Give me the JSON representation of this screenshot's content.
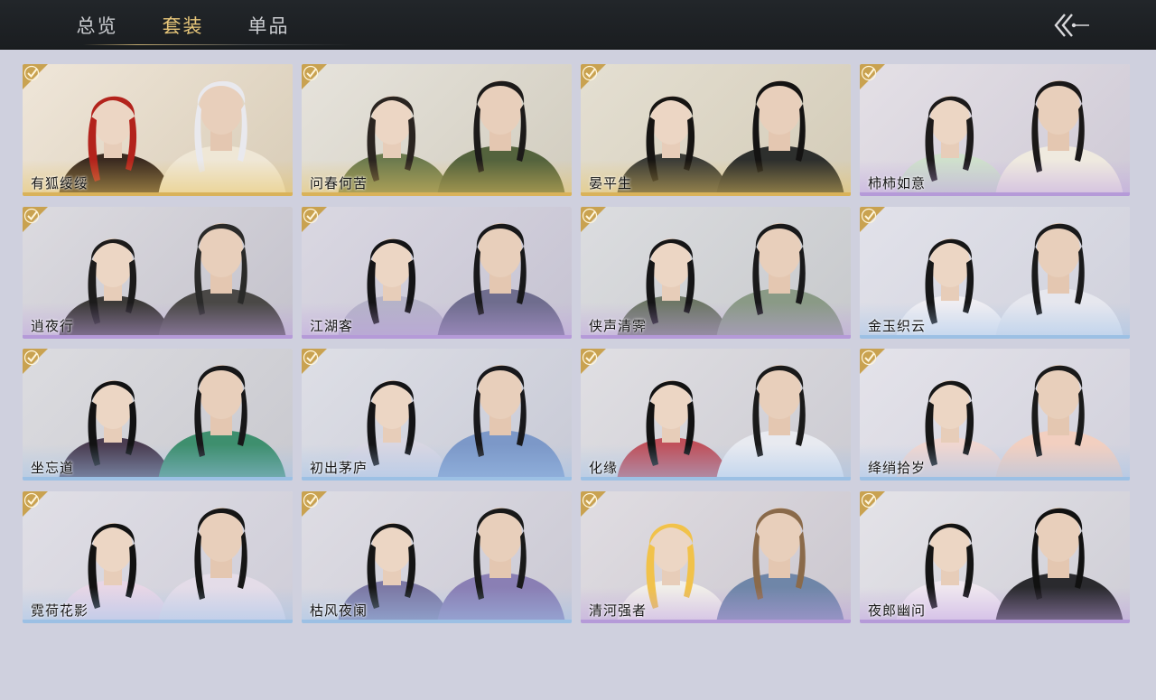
{
  "tabs": [
    {
      "label": "总览",
      "active": false
    },
    {
      "label": "套装",
      "active": true
    },
    {
      "label": "单品",
      "active": false
    }
  ],
  "back_icon": "double-chevron-back-icon",
  "check_icon": "check-corner-icon",
  "accent": "#e8c77a",
  "outfits": [
    {
      "name": "有狐绥绥",
      "owned": true,
      "tone": "gold",
      "bg": [
        "#efe6d9",
        "#d9cdb8"
      ],
      "hair": [
        "#b3231c",
        "#e9e9ee"
      ],
      "cloth": [
        "#3a2a20",
        "#efe7d6"
      ]
    },
    {
      "name": "问春何苦",
      "owned": true,
      "tone": "gold",
      "bg": [
        "#e6e3dc",
        "#d2cdbf"
      ],
      "hair": [
        "#2a2420",
        "#1c1a19"
      ],
      "cloth": [
        "#6c7a4e",
        "#54633d"
      ]
    },
    {
      "name": "晏平生",
      "owned": true,
      "tone": "gold",
      "bg": [
        "#e4dfd2",
        "#d4ccb8"
      ],
      "hair": [
        "#161412",
        "#141312"
      ],
      "cloth": [
        "#3b3c37",
        "#2d2f2d"
      ]
    },
    {
      "name": "柿柿如意",
      "owned": true,
      "tone": "purple",
      "bg": [
        "#e4e0e6",
        "#cfcad6"
      ],
      "hair": [
        "#1c1a1a",
        "#1a1818"
      ],
      "cloth": [
        "#cfe0cc",
        "#efeadf"
      ]
    },
    {
      "name": "逍夜行",
      "owned": true,
      "tone": "purple",
      "bg": [
        "#dcdbe0",
        "#c4c2cc"
      ],
      "hair": [
        "#1c1b1b",
        "#2a2a29"
      ],
      "cloth": [
        "#3c3a38",
        "#4a4846"
      ]
    },
    {
      "name": "江湖客",
      "owned": true,
      "tone": "purple",
      "bg": [
        "#dad8e2",
        "#c6c3d2"
      ],
      "hair": [
        "#141416",
        "#18181a"
      ],
      "cloth": [
        "#b5b3c8",
        "#6f6d8e"
      ]
    },
    {
      "name": "侠声清霁",
      "owned": true,
      "tone": "purple",
      "bg": [
        "#dcdde0",
        "#c7c9cc"
      ],
      "hair": [
        "#151516",
        "#19191a"
      ],
      "cloth": [
        "#6d7766",
        "#8a9a86"
      ]
    },
    {
      "name": "金玉织云",
      "owned": true,
      "tone": "blue",
      "bg": [
        "#e2e2ea",
        "#d0d1dc"
      ],
      "hair": [
        "#161617",
        "#1a1a1b"
      ],
      "cloth": [
        "#f0eef2",
        "#e6e7ee"
      ]
    },
    {
      "name": "坐忘道",
      "owned": true,
      "tone": "blue",
      "bg": [
        "#dcdce0",
        "#c9c9cf"
      ],
      "hair": [
        "#121213",
        "#171718"
      ],
      "cloth": [
        "#4a3c50",
        "#3e8f6e"
      ]
    },
    {
      "name": "初出茅庐",
      "owned": true,
      "tone": "blue",
      "bg": [
        "#dedfe6",
        "#c8cad6"
      ],
      "hair": [
        "#141416",
        "#18181b"
      ],
      "cloth": [
        "#d8d6e2",
        "#7c98c8"
      ]
    },
    {
      "name": "化缘",
      "owned": true,
      "tone": "blue",
      "bg": [
        "#e0dfe3",
        "#cccbd2"
      ],
      "hair": [
        "#121212",
        "#1a1a1a"
      ],
      "cloth": [
        "#c0505a",
        "#e8eaf0"
      ]
    },
    {
      "name": "绛绡拾岁",
      "owned": true,
      "tone": "blue",
      "bg": [
        "#e4e3ea",
        "#d2d1dc"
      ],
      "hair": [
        "#161616",
        "#1a1a1a"
      ],
      "cloth": [
        "#f0d6d0",
        "#f2cfc0"
      ]
    },
    {
      "name": "霓荷花影",
      "owned": true,
      "tone": "blue",
      "bg": [
        "#e0dfe6",
        "#cfcdd8"
      ],
      "hair": [
        "#121212",
        "#161616"
      ],
      "cloth": [
        "#e8d6e6",
        "#e4dce8"
      ]
    },
    {
      "name": "枯风夜阑",
      "owned": true,
      "tone": "blue",
      "bg": [
        "#dedde4",
        "#cbc9d4"
      ],
      "hair": [
        "#151515",
        "#191919"
      ],
      "cloth": [
        "#7c78a4",
        "#8a7fb4"
      ]
    },
    {
      "name": "清河强者",
      "owned": true,
      "tone": "purple",
      "bg": [
        "#e0dde2",
        "#cbc7cf"
      ],
      "hair": [
        "#f1c24a",
        "#8a6a4a"
      ],
      "cloth": [
        "#f1efe9",
        "#6f86a8"
      ]
    },
    {
      "name": "夜郎幽问",
      "owned": true,
      "tone": "purple",
      "bg": [
        "#e4e3e8",
        "#cfced6"
      ],
      "hair": [
        "#141414",
        "#111111"
      ],
      "cloth": [
        "#efe7ef",
        "#2a2a2e"
      ]
    }
  ]
}
